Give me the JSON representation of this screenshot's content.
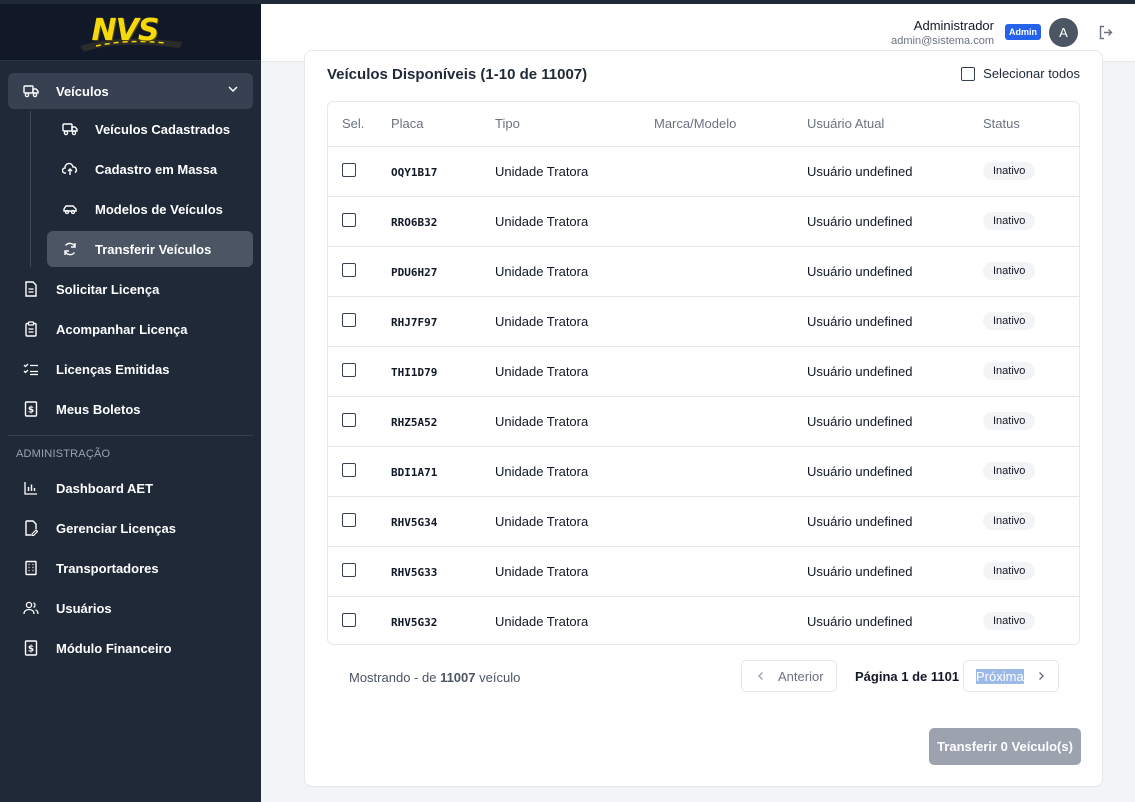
{
  "brand": {
    "logo_text": "NVS"
  },
  "sidebar": {
    "vehicles_label": "Veículos",
    "sub_items": [
      {
        "label": "Veículos Cadastrados",
        "icon": "truck-icon"
      },
      {
        "label": "Cadastro em Massa",
        "icon": "cloud-upload-icon"
      },
      {
        "label": "Modelos de Veículos",
        "icon": "car-icon"
      },
      {
        "label": "Transferir Veículos",
        "icon": "refresh-icon"
      }
    ],
    "items": [
      {
        "label": "Solicitar Licença",
        "icon": "file-text-icon"
      },
      {
        "label": "Acompanhar Licença",
        "icon": "clipboard-icon"
      },
      {
        "label": "Licenças Emitidas",
        "icon": "list-check-icon"
      },
      {
        "label": "Meus Boletos",
        "icon": "dollar-doc-icon"
      }
    ],
    "admin_section_label": "ADMINISTRAÇÃO",
    "admin_items": [
      {
        "label": "Dashboard AET",
        "icon": "bar-chart-icon"
      },
      {
        "label": "Gerenciar Licenças",
        "icon": "file-edit-icon"
      },
      {
        "label": "Transportadores",
        "icon": "building-icon"
      },
      {
        "label": "Usuários",
        "icon": "users-icon"
      },
      {
        "label": "Módulo Financeiro",
        "icon": "dollar-doc-icon"
      }
    ]
  },
  "header": {
    "user_name": "Administrador",
    "user_email": "admin@sistema.com",
    "role_badge": "Admin",
    "avatar_initial": "A"
  },
  "card": {
    "title": "Veículos Disponíveis (1-10 de 11007)",
    "select_all_label": "Selecionar todos",
    "columns": [
      "Sel.",
      "Placa",
      "Tipo",
      "Marca/Modelo",
      "Usuário Atual",
      "Status"
    ],
    "rows": [
      {
        "placa": "OQY1B17",
        "tipo": "Unidade Tratora",
        "marca": "",
        "usuario": "Usuário undefined",
        "status": "Inativo"
      },
      {
        "placa": "RRO6B32",
        "tipo": "Unidade Tratora",
        "marca": "",
        "usuario": "Usuário undefined",
        "status": "Inativo"
      },
      {
        "placa": "PDU6H27",
        "tipo": "Unidade Tratora",
        "marca": "",
        "usuario": "Usuário undefined",
        "status": "Inativo"
      },
      {
        "placa": "RHJ7F97",
        "tipo": "Unidade Tratora",
        "marca": "",
        "usuario": "Usuário undefined",
        "status": "Inativo"
      },
      {
        "placa": "THI1D79",
        "tipo": "Unidade Tratora",
        "marca": "",
        "usuario": "Usuário undefined",
        "status": "Inativo"
      },
      {
        "placa": "RHZ5A52",
        "tipo": "Unidade Tratora",
        "marca": "",
        "usuario": "Usuário undefined",
        "status": "Inativo"
      },
      {
        "placa": "BDI1A71",
        "tipo": "Unidade Tratora",
        "marca": "",
        "usuario": "Usuário undefined",
        "status": "Inativo"
      },
      {
        "placa": "RHV5G34",
        "tipo": "Unidade Tratora",
        "marca": "",
        "usuario": "Usuário undefined",
        "status": "Inativo"
      },
      {
        "placa": "RHV5G33",
        "tipo": "Unidade Tratora",
        "marca": "",
        "usuario": "Usuário undefined",
        "status": "Inativo"
      },
      {
        "placa": "RHV5G32",
        "tipo": "Unidade Tratora",
        "marca": "",
        "usuario": "Usuário undefined",
        "status": "Inativo"
      }
    ],
    "footer": {
      "showing_prefix": "Mostrando - de",
      "total": "11007",
      "showing_suffix": "veículo",
      "prev_label": "Anterior",
      "page_info": "Página 1 de 1101",
      "next_label": "Próxima"
    },
    "transfer_button": "Transferir 0 Veículo(s)"
  }
}
